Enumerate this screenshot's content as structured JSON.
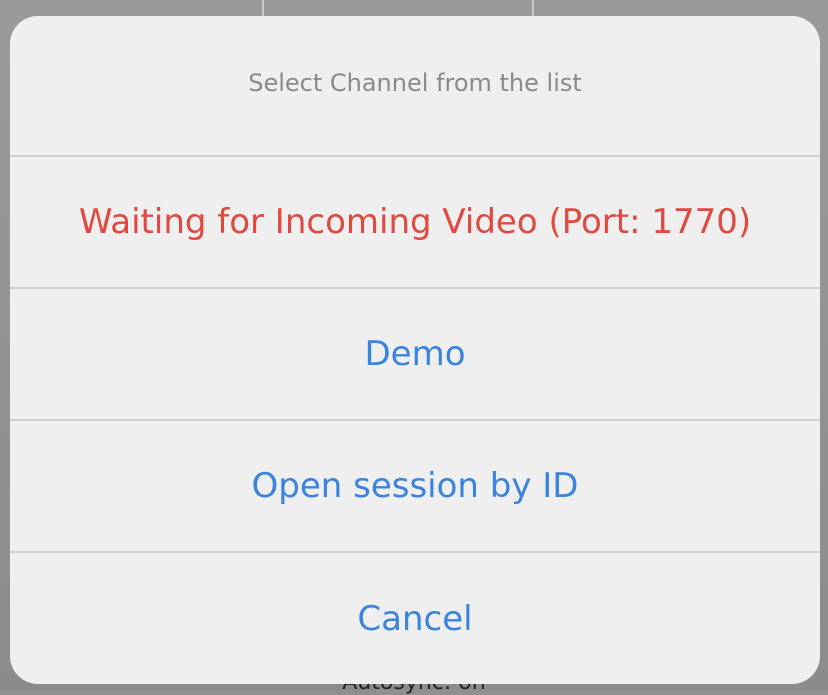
{
  "background": {
    "partial_text": "Autosync: on"
  },
  "action_sheet": {
    "title": "Select Channel from the list",
    "actions": [
      {
        "label": "Waiting for Incoming Video (Port: 1770)",
        "style": "destructive"
      },
      {
        "label": "Demo",
        "style": "default"
      },
      {
        "label": "Open session by ID",
        "style": "default"
      },
      {
        "label": "Cancel",
        "style": "cancel"
      }
    ]
  },
  "colors": {
    "destructive": "#e0493f",
    "accent": "#3a84e0",
    "title_gray": "#8a8a8a",
    "sheet_background": "#efefef"
  }
}
